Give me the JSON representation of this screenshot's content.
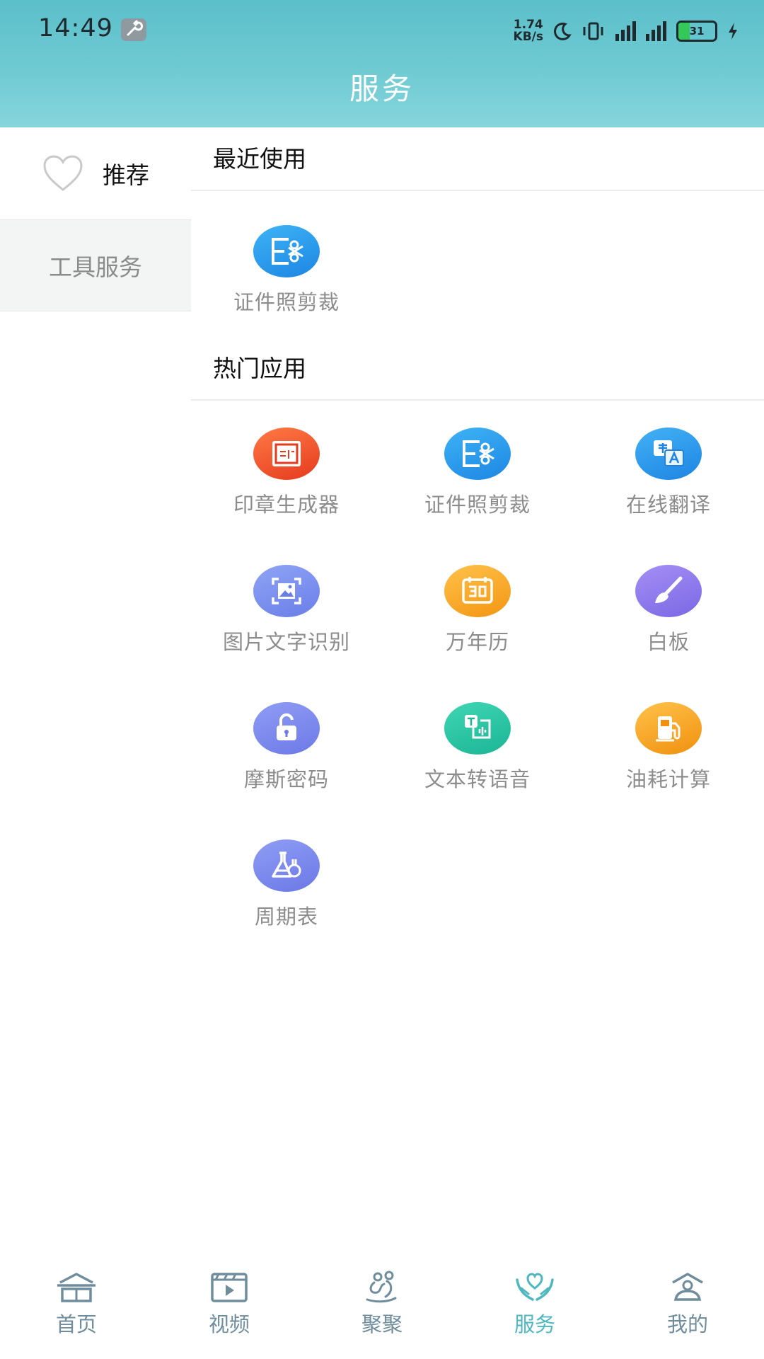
{
  "status_bar": {
    "time": "14:49",
    "net_speed_value": "1.74",
    "net_speed_unit": "KB/s",
    "battery": "31",
    "battery_level": 0.31
  },
  "header": {
    "title": "服务"
  },
  "sidebar": {
    "items": [
      {
        "label": "推荐",
        "icon": "heart-icon"
      },
      {
        "label": "工具服务"
      }
    ]
  },
  "sections": {
    "recent": {
      "title": "最近使用",
      "apps": [
        {
          "label": "证件照剪裁",
          "icon": "id-photo-crop-icon"
        }
      ]
    },
    "hot": {
      "title": "热门应用",
      "apps": [
        {
          "label": "印章生成器",
          "icon": "seal-icon",
          "colors": [
            "#ff7a45",
            "#e53a1e"
          ]
        },
        {
          "label": "证件照剪裁",
          "icon": "id-photo-crop-icon",
          "colors": [
            "#3fb3f5",
            "#1c86e3"
          ]
        },
        {
          "label": "在线翻译",
          "icon": "translate-icon",
          "colors": [
            "#43b2f5",
            "#1d84e2"
          ]
        },
        {
          "label": "图片文字识别",
          "icon": "image-ocr-icon",
          "colors": [
            "#8fa4f5",
            "#6a7ee8"
          ]
        },
        {
          "label": "万年历",
          "icon": "calendar-icon",
          "colors": [
            "#ffc24a",
            "#f39512"
          ]
        },
        {
          "label": "白板",
          "icon": "brush-icon",
          "colors": [
            "#a58ff5",
            "#7a68e4"
          ]
        },
        {
          "label": "摩斯密码",
          "icon": "lock-icon",
          "colors": [
            "#8f9df5",
            "#6d79e6"
          ]
        },
        {
          "label": "文本转语音",
          "icon": "text-to-speech-icon",
          "colors": [
            "#3fd6b4",
            "#1bb595"
          ]
        },
        {
          "label": "油耗计算",
          "icon": "fuel-icon",
          "colors": [
            "#ffc24a",
            "#f0900e"
          ]
        },
        {
          "label": "周期表",
          "icon": "flask-icon",
          "colors": [
            "#8f9df5",
            "#6b78e6"
          ]
        }
      ]
    }
  },
  "bottom_nav": {
    "items": [
      {
        "label": "首页",
        "icon": "home-icon"
      },
      {
        "label": "视频",
        "icon": "video-icon"
      },
      {
        "label": "聚聚",
        "icon": "gathering-icon"
      },
      {
        "label": "服务",
        "icon": "service-hands-heart-icon",
        "active": true
      },
      {
        "label": "我的",
        "icon": "profile-icon"
      }
    ]
  },
  "colors": {
    "header_gradient_top": "#5bbfca",
    "header_gradient_bottom": "#86d5dc",
    "nav_active": "#4fb7c0",
    "nav_inactive": "#6f8d9c"
  }
}
